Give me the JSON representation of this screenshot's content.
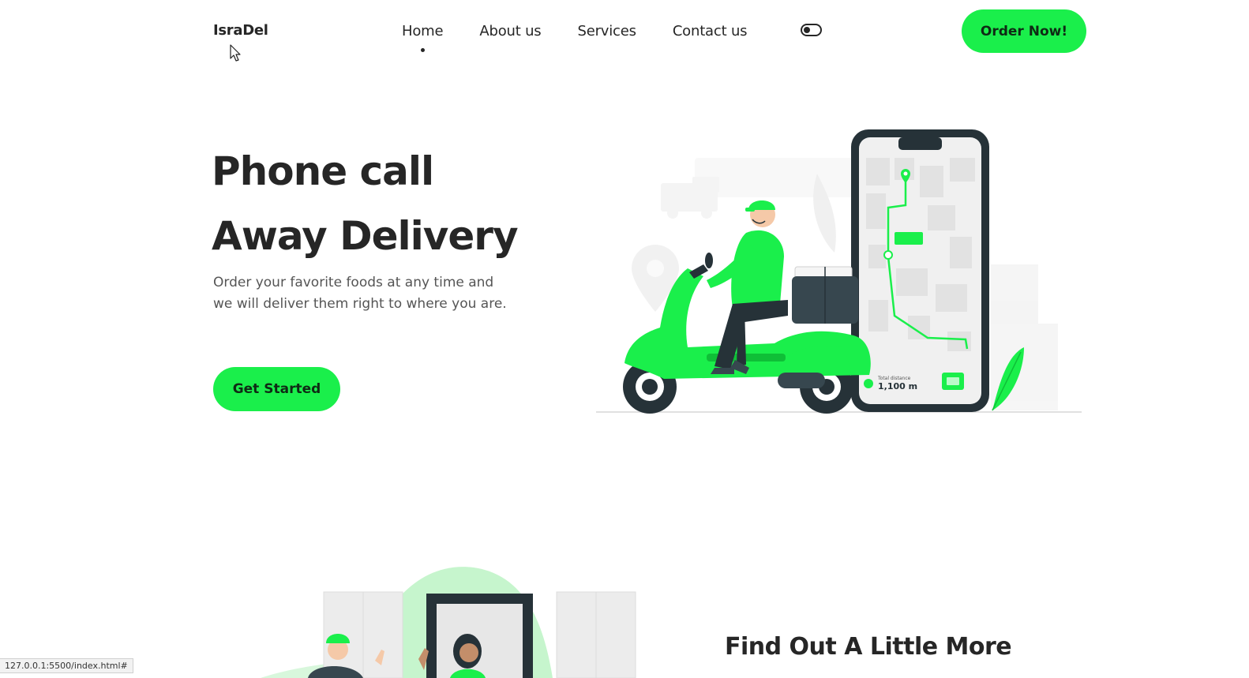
{
  "header": {
    "logo": "IsraDel",
    "nav": [
      {
        "label": "Home",
        "active": true
      },
      {
        "label": "About us",
        "active": false
      },
      {
        "label": "Services",
        "active": false
      },
      {
        "label": "Contact us",
        "active": false
      }
    ],
    "theme_toggle_icon": "toggle-icon",
    "order_button": "Order Now!"
  },
  "hero": {
    "title_line1": "Phone call",
    "title_line2": "Away Delivery",
    "description": "Order your favorite foods at any time and we will deliver them right to where you are.",
    "cta_button": "Get Started",
    "illustration": {
      "distance_label": "Total distance",
      "distance_value": "1,100 m"
    }
  },
  "about": {
    "heading": "Find Out A Little More"
  },
  "status_bar": {
    "url": "127.0.0.1:5500/index.html#"
  },
  "colors": {
    "accent": "#1aef4b",
    "text": "#262626",
    "muted": "#555555"
  }
}
